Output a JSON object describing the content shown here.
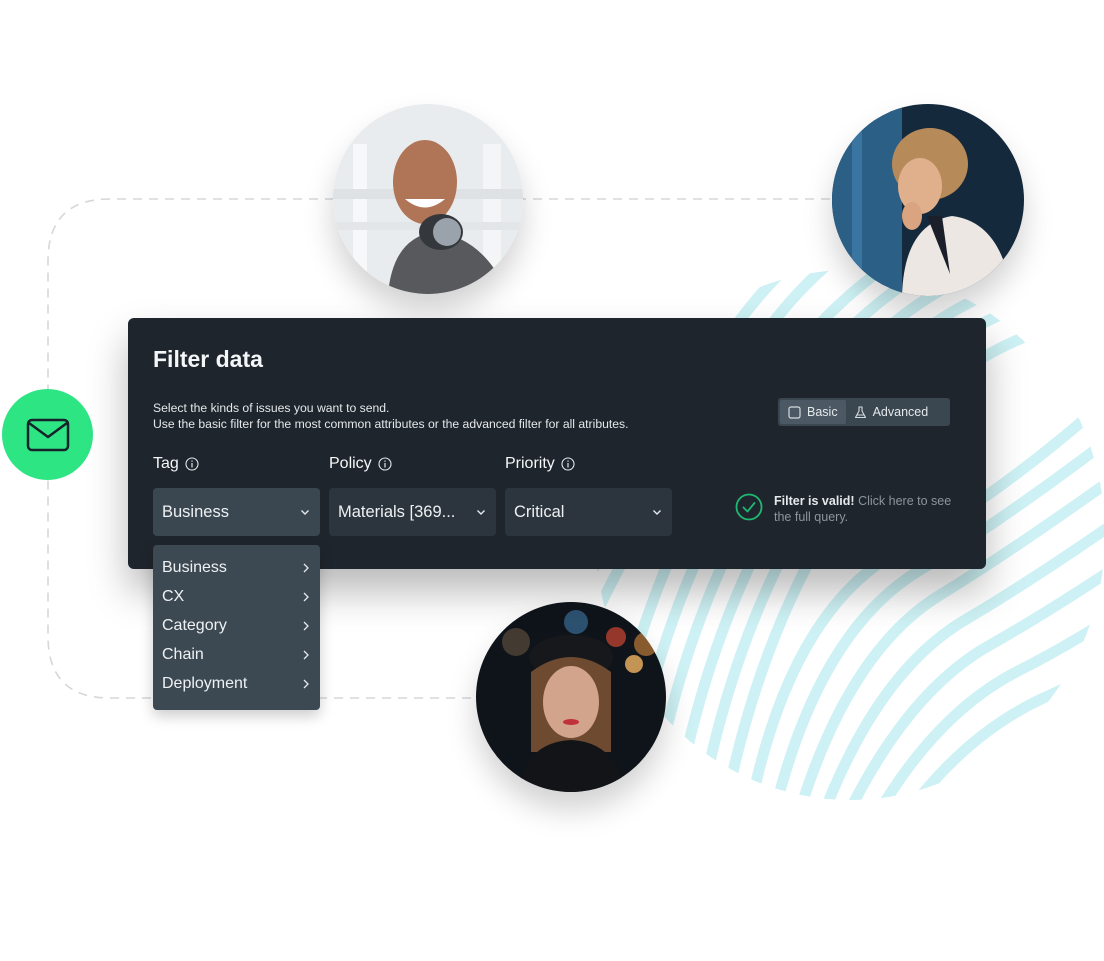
{
  "card": {
    "title": "Filter data",
    "description_line1": "Select the kinds of issues you want to send.",
    "description_line2": "Use the basic filter for the most common attributes or the advanced filter for all atributes."
  },
  "mode_toggle": {
    "options": [
      {
        "label": "Basic",
        "icon": "square-icon",
        "active": true
      },
      {
        "label": "Advanced",
        "icon": "flask-icon",
        "active": false
      }
    ]
  },
  "fields": [
    {
      "label": "Tag",
      "value": "Business",
      "open": true
    },
    {
      "label": "Policy",
      "value": "Materials [369...",
      "open": false
    },
    {
      "label": "Priority",
      "value": "Critical",
      "open": false
    }
  ],
  "tag_dropdown": {
    "items": [
      "Business",
      "CX",
      "Category",
      "Chain",
      "Deployment"
    ]
  },
  "validation": {
    "status": "Filter is valid!",
    "link_text": "Click here to see the full query."
  },
  "colors": {
    "card_bg": "#1f252c",
    "accent_green": "#2ee584",
    "valid_green": "#1fb872",
    "stripe_cyan": "#cdf1f4"
  }
}
